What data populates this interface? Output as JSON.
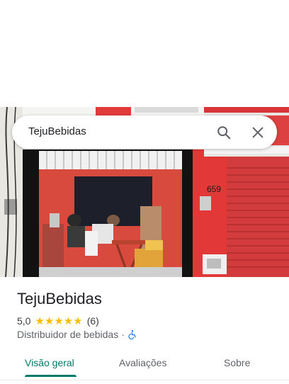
{
  "search": {
    "query": "TejuBebidas"
  },
  "place": {
    "name": "TejuBebidas",
    "rating": "5,0",
    "stars": "★★★★★",
    "review_count": "(6)",
    "category": "Distribuidor de bebidas",
    "separator": "·"
  },
  "photo": {
    "house_number": "659"
  },
  "tabs": [
    {
      "label": "Visão geral"
    },
    {
      "label": "Avaliações"
    },
    {
      "label": "Sobre"
    }
  ],
  "colors": {
    "accent": "#00796b",
    "star": "#fbbc04",
    "accessibility": "#1a73e8"
  }
}
